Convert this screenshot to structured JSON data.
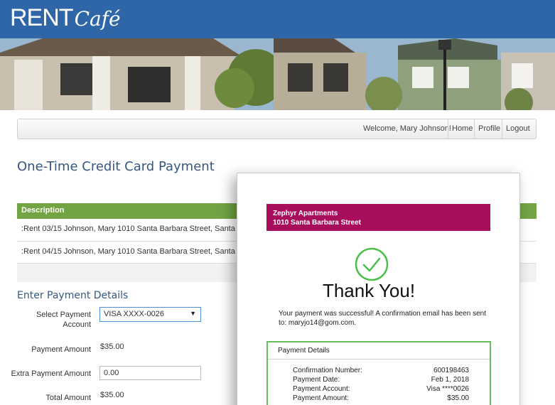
{
  "header": {
    "logo_rent": "RENT",
    "logo_cafe": "Café"
  },
  "nav": {
    "welcome": "Welcome, Mary Johnson!",
    "home": "Home",
    "profile": "Profile",
    "logout": "Logout"
  },
  "page": {
    "title": "One-Time Credit Card Payment"
  },
  "table": {
    "header": "Description",
    "rows": [
      ":Rent 03/15 Johnson, Mary 1010 Santa Barbara Street, Santa Barb",
      ":Rent 04/15 Johnson, Mary 1010 Santa Barbara Street, Santa Barb"
    ]
  },
  "form": {
    "section_title": "Enter Payment Details",
    "select_label_1": "Select Payment",
    "select_label_2": "Account",
    "select_value": "VISA XXXX-0026",
    "payment_amount_label": "Payment Amount",
    "payment_amount_value": "$35.00",
    "extra_label": "Extra Payment Amount",
    "extra_value": "0.00",
    "total_label": "Total Amount",
    "total_value": "$35.00"
  },
  "modal": {
    "property_name": "Zephyr Apartments",
    "property_address": "1010 Santa Barbara Street",
    "thank_you": "Thank You!",
    "message_line1": "Your payment was successful!  A confirmation email has been sent",
    "message_line2": "to: maryjo14@gom.com.",
    "details_title": "Payment Details",
    "details": [
      {
        "label": "Confirmation Number:",
        "value": "600198463"
      },
      {
        "label": "Payment Date:",
        "value": "Feb 1, 2018"
      },
      {
        "label": "Payment Account:",
        "value": "Visa ****0026"
      },
      {
        "label": "Payment Amount:",
        "value": "$35.00"
      }
    ]
  },
  "colors": {
    "header_blue": "#2f66a8",
    "table_green": "#72a444",
    "banner_magenta": "#a90e5c",
    "check_green": "#4cbf4a"
  },
  "icons": {
    "check": "check-circle-icon",
    "dropdown": "chevron-down-icon"
  }
}
